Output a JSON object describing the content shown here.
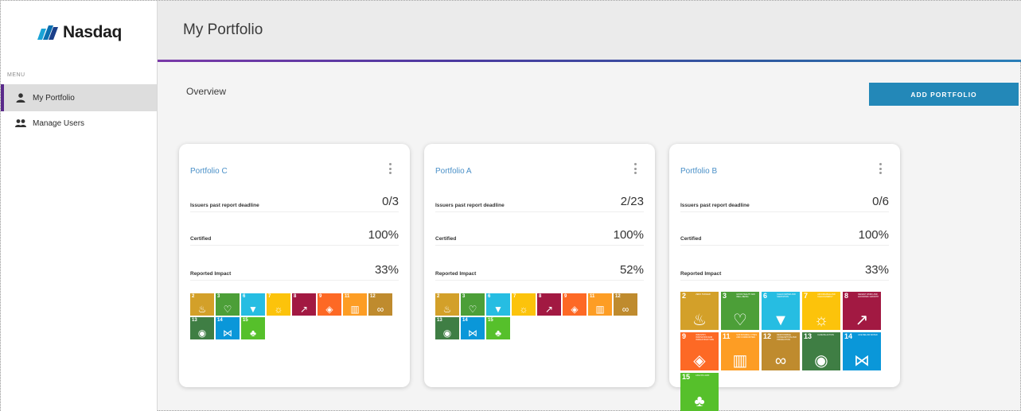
{
  "app": {
    "brand": "Nasdaq",
    "page_title": "My Portfolio"
  },
  "sidebar": {
    "menu_label": "MENU",
    "items": [
      {
        "label": "My Portfolio",
        "icon": "user-icon",
        "active": true
      },
      {
        "label": "Manage Users",
        "icon": "users-icon",
        "active": false
      }
    ]
  },
  "main": {
    "section_title": "Overview",
    "add_button_label": "ADD PORTFOLIO"
  },
  "colors": {
    "accent_blue": "#2388b8",
    "link_blue": "#4a90c8",
    "active_purple": "#5a2a8a"
  },
  "portfolios": [
    {
      "title": "Portfolio C",
      "metrics": [
        {
          "label": "Issuers past report deadline",
          "value": "0/3"
        },
        {
          "label": "Certified",
          "value": "100%"
        },
        {
          "label": "Reported Impact",
          "value": "33%"
        }
      ]
    },
    {
      "title": "Portfolio A",
      "metrics": [
        {
          "label": "Issuers past report deadline",
          "value": "2/23"
        },
        {
          "label": "Certified",
          "value": "100%"
        },
        {
          "label": "Reported Impact",
          "value": "52%"
        }
      ]
    },
    {
      "title": "Portfolio B",
      "metrics": [
        {
          "label": "Issuers past report deadline",
          "value": "0/6"
        },
        {
          "label": "Certified",
          "value": "100%"
        },
        {
          "label": "Reported Impact",
          "value": "33%"
        }
      ]
    }
  ],
  "sdg_goals": [
    {
      "num": "2",
      "label": "ZERO HUNGER",
      "color": "#D3A029",
      "icon": "bowl-icon",
      "glyph": "♨"
    },
    {
      "num": "3",
      "label": "GOOD HEALTH AND WELL-BEING",
      "color": "#4C9F38",
      "icon": "heartbeat-icon",
      "glyph": "♡"
    },
    {
      "num": "6",
      "label": "CLEAN WATER AND SANITATION",
      "color": "#26BDE2",
      "icon": "water-icon",
      "glyph": "▼"
    },
    {
      "num": "7",
      "label": "AFFORDABLE AND CLEAN ENERGY",
      "color": "#FCC30B",
      "icon": "sun-icon",
      "glyph": "☼"
    },
    {
      "num": "8",
      "label": "DECENT WORK AND ECONOMIC GROWTH",
      "color": "#A21942",
      "icon": "growth-chart-icon",
      "glyph": "↗"
    },
    {
      "num": "9",
      "label": "INDUSTRY, INNOVATION AND INFRASTRUCTURE",
      "color": "#FD6925",
      "icon": "cubes-icon",
      "glyph": "◈"
    },
    {
      "num": "11",
      "label": "SUSTAINABLE CITIES AND COMMUNITIES",
      "color": "#FD9D24",
      "icon": "buildings-icon",
      "glyph": "▥"
    },
    {
      "num": "12",
      "label": "RESPONSIBLE CONSUMPTION AND PRODUCTION",
      "color": "#BF8B2E",
      "icon": "infinity-icon",
      "glyph": "∞"
    },
    {
      "num": "13",
      "label": "CLIMATE ACTION",
      "color": "#3F7E44",
      "icon": "eye-globe-icon",
      "glyph": "◉"
    },
    {
      "num": "14",
      "label": "LIFE BELOW WATER",
      "color": "#0A97D9",
      "icon": "fish-icon",
      "glyph": "⋈"
    },
    {
      "num": "15",
      "label": "LIFE ON LAND",
      "color": "#56C02B",
      "icon": "tree-icon",
      "glyph": "♣"
    }
  ]
}
